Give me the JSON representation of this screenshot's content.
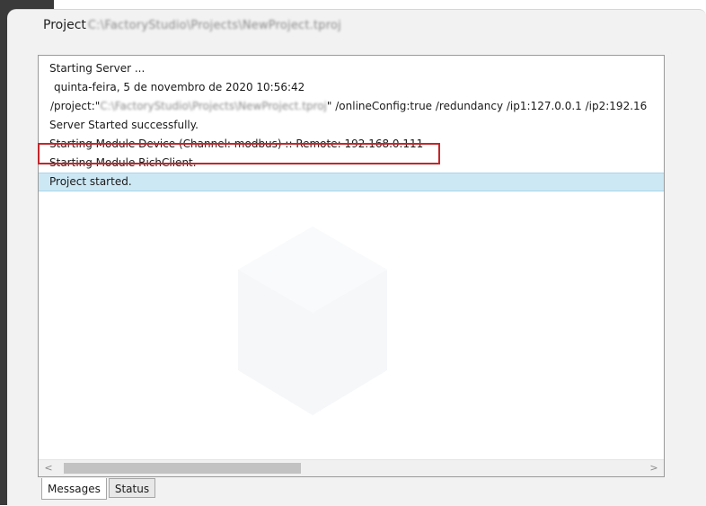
{
  "window": {
    "title_label": "Project",
    "title_path": "C:\\FactoryStudio\\Projects\\NewProject.tproj"
  },
  "log": {
    "lines": [
      {
        "text": "Starting Server ..."
      },
      {
        "text": "quinta-feira, 5 de novembro de 2020   10:56:42"
      },
      {
        "prefix": "/project:\"",
        "path": "C:\\FactoryStudio\\Projects\\NewProject.tproj",
        "suffix": "\"  /onlineConfig:true /redundancy /ip1:127.0.0.1 /ip2:192.16"
      },
      {
        "text": "Server Started successfully."
      },
      {
        "text": "Starting Module Device (Channel: modbus) :: Remote: 192.168.0.111"
      },
      {
        "text": "Starting Module RichClient."
      },
      {
        "text": "Project started."
      }
    ],
    "selected_index": 6,
    "highlighted_index": 4
  },
  "scrollbar": {
    "left_arrow": "<",
    "right_arrow": ">"
  },
  "tabs": [
    {
      "label": "Messages",
      "active": true
    },
    {
      "label": "Status",
      "active": false
    }
  ],
  "colors": {
    "highlight_border": "#c3262b",
    "selection_bg": "#cde8f5"
  }
}
